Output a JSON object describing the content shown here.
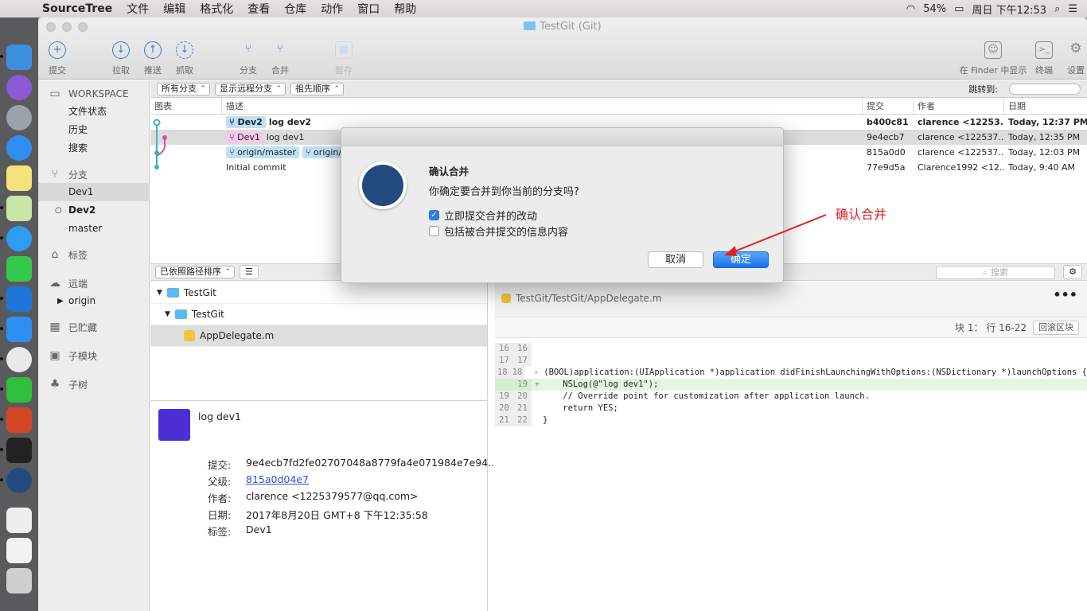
{
  "menubar": {
    "app": "SourceTree",
    "items": [
      "文件",
      "编辑",
      "格式化",
      "查看",
      "仓库",
      "动作",
      "窗口",
      "帮助"
    ],
    "battery": "54%",
    "clock": "周日 下午12:53"
  },
  "window": {
    "title": "TestGit (Git)"
  },
  "toolbar": {
    "commit": "提交",
    "pull": "拉取",
    "push": "推送",
    "fetch": "抓取",
    "branch": "分支",
    "merge": "合并",
    "stash": "暂存",
    "finder": "在 Finder 中显示",
    "terminal": "终端",
    "settings": "设置"
  },
  "sidebar": {
    "workspace": "WORKSPACE",
    "file_status": "文件状态",
    "history": "历史",
    "search": "搜索",
    "branches": "分支",
    "branch_items": [
      "Dev1",
      "Dev2",
      "master"
    ],
    "tags": "标签",
    "remotes": "远端",
    "origin": "origin",
    "stashes": "已贮藏",
    "submodules": "子模块",
    "subtrees": "子树"
  },
  "filters": {
    "all_branches": "所有分支",
    "show_remote": "显示远程分支",
    "ancestor_order": "祖先顺序",
    "jump_to": "跳转到:"
  },
  "columns": {
    "graph": "图表",
    "desc": "描述",
    "commit": "提交",
    "author": "作者",
    "date": "日期"
  },
  "commits": [
    {
      "tags": [
        "Dev2"
      ],
      "msg": "log dev2",
      "hash": "b400c81",
      "author": "clarence <12253...",
      "date": "Today, 12:37 PM"
    },
    {
      "tags": [
        "Dev1"
      ],
      "msg": "log dev1",
      "hash": "9e4ecb7",
      "author": "clarence <122537...",
      "date": "Today, 12:35 PM"
    },
    {
      "tags": [
        "origin/master",
        "origin/HE"
      ],
      "msg": "",
      "hash": "815a0d0",
      "author": "clarence <122537...",
      "date": "Today, 12:03 PM"
    },
    {
      "tags": [],
      "msg": "Initial commit",
      "hash": "77e9d5a",
      "author": "Clarence1992 <12...",
      "date": "Today, 9:40 AM"
    }
  ],
  "midbar": {
    "sort": "已依照路径排序",
    "search_placeholder": "搜索"
  },
  "files": {
    "root": "TestGit",
    "folder": "TestGit",
    "file": "AppDelegate.m"
  },
  "detail": {
    "subject": "log dev1",
    "k_commit": "提交:",
    "commit": "9e4ecb7fd2fe02707048a8779fa4e071984e7e94...",
    "k_parent": "父级:",
    "parent": "815a0d04e7",
    "k_author": "作者:",
    "author": "clarence <1225379577@qq.com>",
    "k_date": "日期:",
    "date": "2017年8月20日 GMT+8 下午12:35:58",
    "k_tags": "标签:",
    "tags": "Dev1"
  },
  "diff": {
    "path": "TestGit/TestGit/AppDelegate.m",
    "hunk": "块 1： 行 16-22",
    "revert": "回滚区块",
    "lines": [
      {
        "a": "16",
        "b": "16",
        "m": "",
        "t": ""
      },
      {
        "a": "17",
        "b": "17",
        "m": "",
        "t": ""
      },
      {
        "a": "18",
        "b": "18",
        "m": "",
        "t": "- (BOOL)application:(UIApplication *)application didFinishLaunchingWithOptions:(NSDictionary *)launchOptions {"
      },
      {
        "a": "",
        "b": "19",
        "m": "+",
        "t": "    NSLog(@\"log dev1\");"
      },
      {
        "a": "19",
        "b": "20",
        "m": "",
        "t": "    // Override point for customization after application launch."
      },
      {
        "a": "20",
        "b": "21",
        "m": "",
        "t": "    return YES;"
      },
      {
        "a": "21",
        "b": "22",
        "m": "",
        "t": "}"
      }
    ]
  },
  "dialog": {
    "title": "确认合并",
    "message": "你确定要合并到你当前的分支吗?",
    "opt1": "立即提交合并的改动",
    "opt2": "包括被合并提交的信息内容",
    "cancel": "取消",
    "ok": "确定"
  },
  "annotation": "确认合并"
}
